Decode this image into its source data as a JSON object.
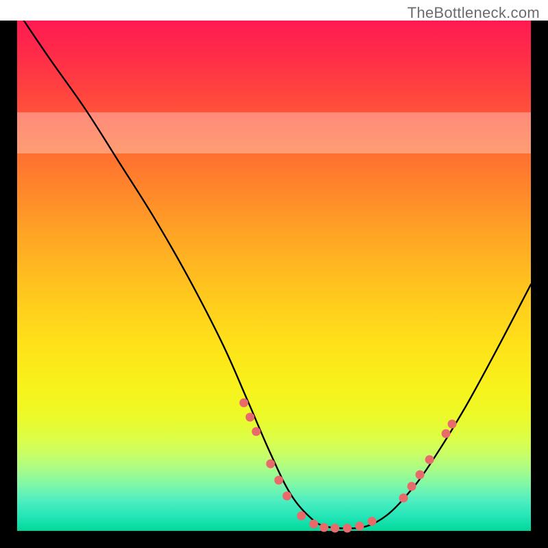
{
  "watermark": "TheBottleneck.com",
  "chart_data": {
    "type": "line",
    "title": "",
    "xlabel": "",
    "ylabel": "",
    "xlim": [
      0,
      100
    ],
    "ylim": [
      0,
      100
    ],
    "background_gradient": {
      "top": "#ff1a52",
      "bottom": "#00d99a"
    },
    "pale_band_y": [
      74,
      82
    ],
    "curve": {
      "name": "bottleneck-curve",
      "x": [
        1.3,
        6.7,
        13.3,
        20.0,
        26.7,
        33.3,
        40.0,
        44.7,
        49.3,
        53.3,
        57.3,
        60.0,
        64.0,
        68.0,
        72.0,
        76.0,
        80.0,
        86.7,
        93.3,
        100.0
      ],
      "y": [
        100.0,
        92.0,
        82.6,
        72.0,
        61.3,
        49.7,
        36.6,
        25.9,
        15.2,
        7.1,
        2.4,
        0.9,
        0.5,
        0.9,
        3.1,
        7.2,
        12.5,
        23.3,
        35.4,
        48.3
      ]
    },
    "dots": {
      "name": "highlight-dots",
      "points": [
        {
          "x": 44.1,
          "y": 25.1
        },
        {
          "x": 45.3,
          "y": 22.3
        },
        {
          "x": 46.5,
          "y": 19.5
        },
        {
          "x": 49.3,
          "y": 13.2
        },
        {
          "x": 50.9,
          "y": 9.9
        },
        {
          "x": 52.5,
          "y": 6.8
        },
        {
          "x": 55.3,
          "y": 3.0
        },
        {
          "x": 57.7,
          "y": 1.3
        },
        {
          "x": 59.7,
          "y": 0.7
        },
        {
          "x": 61.9,
          "y": 0.5
        },
        {
          "x": 64.3,
          "y": 0.5
        },
        {
          "x": 66.7,
          "y": 0.9
        },
        {
          "x": 69.1,
          "y": 1.9
        },
        {
          "x": 75.2,
          "y": 6.5
        },
        {
          "x": 76.8,
          "y": 8.7
        },
        {
          "x": 78.4,
          "y": 11.0
        },
        {
          "x": 80.3,
          "y": 13.9
        },
        {
          "x": 83.5,
          "y": 19.0
        },
        {
          "x": 84.7,
          "y": 21.0
        }
      ]
    }
  }
}
